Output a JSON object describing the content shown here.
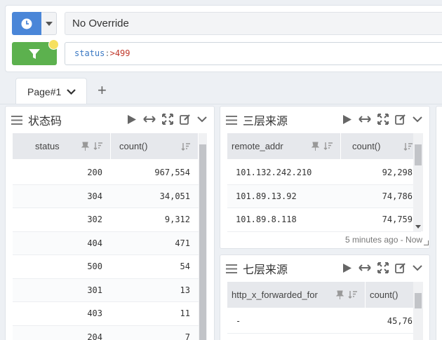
{
  "query_bar": {
    "time_override": "No Override",
    "query_key": "status",
    "query_op": ":",
    "query_value": ">499"
  },
  "tabs": [
    {
      "label": "Page#1"
    }
  ],
  "panels": {
    "status_code": {
      "title": "状态码",
      "columns": [
        "status",
        "count()"
      ],
      "rows": [
        [
          "200",
          "967,554"
        ],
        [
          "304",
          "34,051"
        ],
        [
          "302",
          "9,312"
        ],
        [
          "404",
          "471"
        ],
        [
          "500",
          "54"
        ],
        [
          "301",
          "13"
        ],
        [
          "403",
          "11"
        ],
        [
          "204",
          "7"
        ]
      ]
    },
    "l3_source": {
      "title": "三层来源",
      "columns": [
        "remote_addr",
        "count()"
      ],
      "rows": [
        [
          "101.132.242.210",
          "92,298"
        ],
        [
          "101.89.13.92",
          "74,786"
        ],
        [
          "101.89.8.118",
          "74,759"
        ]
      ],
      "footnote": "5 minutes ago - Now"
    },
    "l7_source": {
      "title": "七层来源",
      "columns": [
        "http_x_forwarded_for",
        "count()"
      ],
      "rows": [
        [
          "-",
          "45,76"
        ]
      ]
    }
  }
}
